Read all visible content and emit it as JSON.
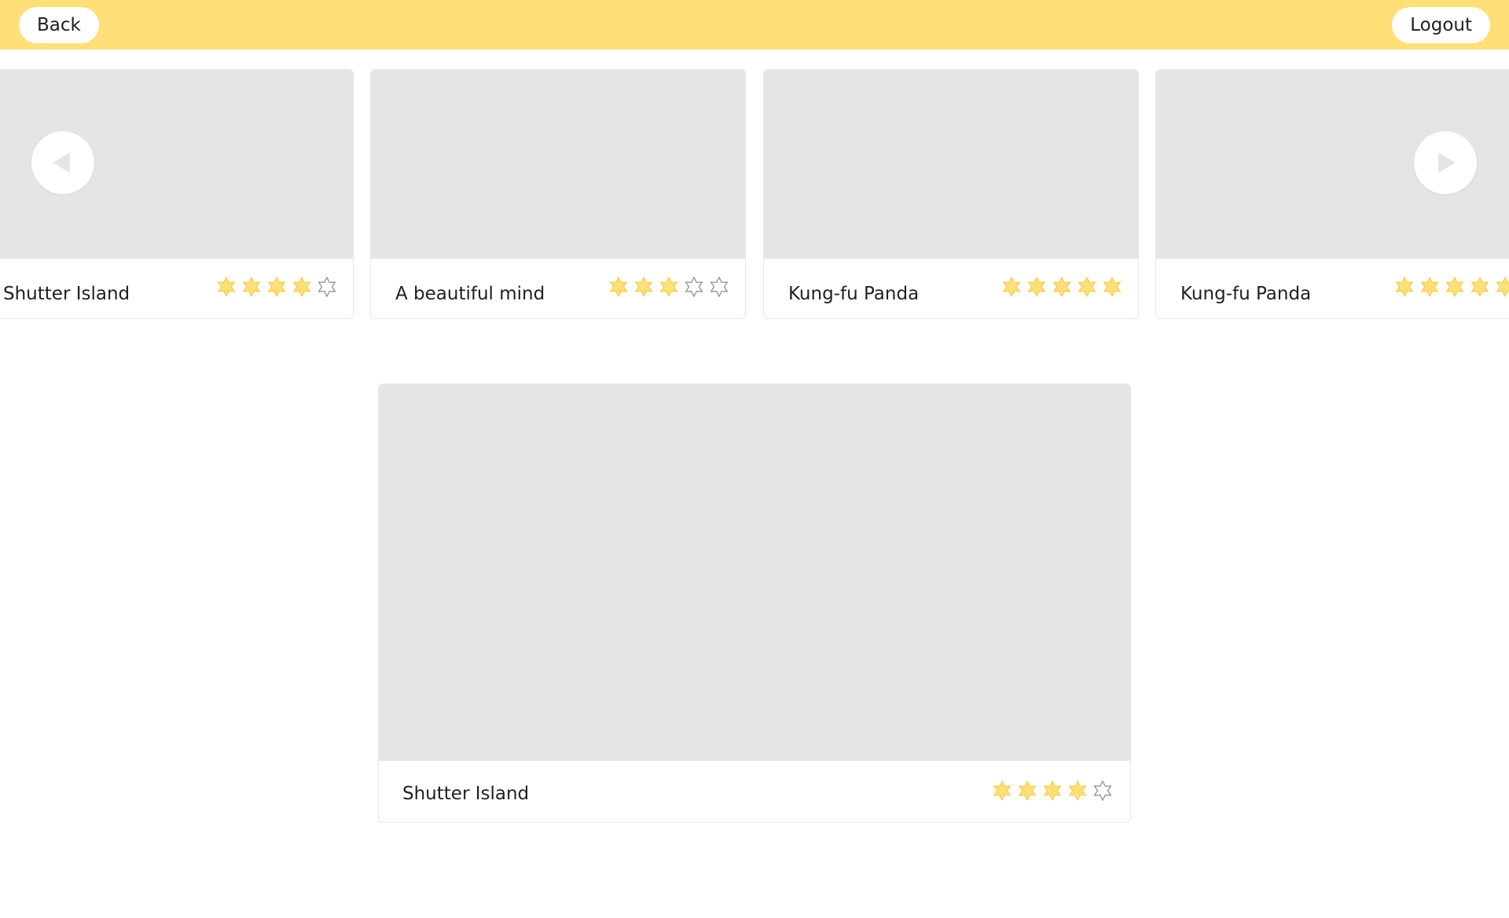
{
  "header": {
    "back_label": "Back",
    "logout_label": "Logout",
    "accent_color": "#ffdf78"
  },
  "carousel": {
    "prev_icon": "triangle-left-icon",
    "next_icon": "triangle-right-icon",
    "cards": [
      {
        "title": "Shutter Island",
        "rating": 4,
        "max_rating": 5
      },
      {
        "title": "A beautiful mind",
        "rating": 3,
        "max_rating": 5
      },
      {
        "title": "Kung-fu Panda",
        "rating": 5,
        "max_rating": 5
      },
      {
        "title": "Kung-fu Panda",
        "rating": 5,
        "max_rating": 5
      }
    ]
  },
  "featured": {
    "title": "Shutter Island",
    "rating": 4,
    "max_rating": 5
  }
}
